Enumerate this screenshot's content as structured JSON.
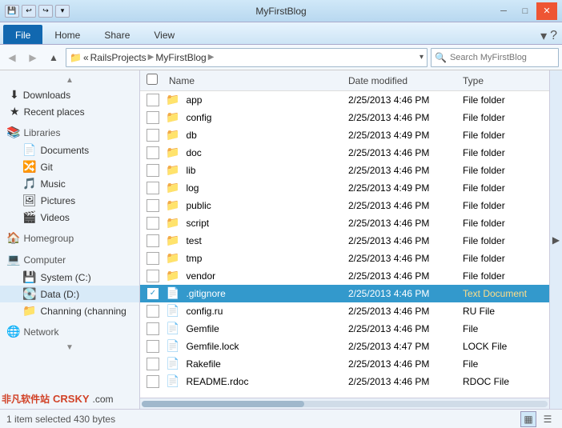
{
  "titleBar": {
    "title": "MyFirstBlog",
    "controls": {
      "minimize": "─",
      "maximize": "□",
      "close": "✕"
    }
  },
  "ribbonTabs": {
    "active": "File",
    "tabs": [
      "File",
      "Home",
      "Share",
      "View"
    ],
    "helpIcon": "?"
  },
  "addressBar": {
    "breadcrumb": [
      "RailsProjects",
      "MyFirstBlog"
    ],
    "searchPlaceholder": "Search MyFirstBlog"
  },
  "sidebar": {
    "items": [
      {
        "icon": "⬇",
        "label": "Downloads",
        "type": "item",
        "indent": 1
      },
      {
        "icon": "★",
        "label": "Recent places",
        "type": "item",
        "indent": 1
      },
      {
        "icon": "📚",
        "label": "Libraries",
        "type": "group"
      },
      {
        "icon": "📄",
        "label": "Documents",
        "type": "item",
        "indent": 1
      },
      {
        "icon": "🔀",
        "label": "Git",
        "type": "item",
        "indent": 1
      },
      {
        "icon": "🎵",
        "label": "Music",
        "type": "item",
        "indent": 1
      },
      {
        "icon": "🖼",
        "label": "Pictures",
        "type": "item",
        "indent": 1
      },
      {
        "icon": "🎬",
        "label": "Videos",
        "type": "item",
        "indent": 1
      },
      {
        "icon": "🏠",
        "label": "Homegroup",
        "type": "group"
      },
      {
        "icon": "💻",
        "label": "Computer",
        "type": "group"
      },
      {
        "icon": "💾",
        "label": "System (C:)",
        "type": "item",
        "indent": 1
      },
      {
        "icon": "💽",
        "label": "Data (D:)",
        "type": "item",
        "indent": 1
      },
      {
        "icon": "📁",
        "label": "Channing (channing",
        "type": "item",
        "indent": 1
      },
      {
        "icon": "🌐",
        "label": "Network",
        "type": "group"
      }
    ]
  },
  "filePane": {
    "columns": {
      "name": "Name",
      "dateModified": "Date modified",
      "type": "Type"
    },
    "files": [
      {
        "name": "app",
        "date": "2/25/2013 4:46 PM",
        "type": "File folder",
        "isFolder": true,
        "selected": false
      },
      {
        "name": "config",
        "date": "2/25/2013 4:46 PM",
        "type": "File folder",
        "isFolder": true,
        "selected": false
      },
      {
        "name": "db",
        "date": "2/25/2013 4:49 PM",
        "type": "File folder",
        "isFolder": true,
        "selected": false
      },
      {
        "name": "doc",
        "date": "2/25/2013 4:46 PM",
        "type": "File folder",
        "isFolder": true,
        "selected": false
      },
      {
        "name": "lib",
        "date": "2/25/2013 4:46 PM",
        "type": "File folder",
        "isFolder": true,
        "selected": false
      },
      {
        "name": "log",
        "date": "2/25/2013 4:49 PM",
        "type": "File folder",
        "isFolder": true,
        "selected": false
      },
      {
        "name": "public",
        "date": "2/25/2013 4:46 PM",
        "type": "File folder",
        "isFolder": true,
        "selected": false
      },
      {
        "name": "script",
        "date": "2/25/2013 4:46 PM",
        "type": "File folder",
        "isFolder": true,
        "selected": false
      },
      {
        "name": "test",
        "date": "2/25/2013 4:46 PM",
        "type": "File folder",
        "isFolder": true,
        "selected": false
      },
      {
        "name": "tmp",
        "date": "2/25/2013 4:46 PM",
        "type": "File folder",
        "isFolder": true,
        "selected": false
      },
      {
        "name": "vendor",
        "date": "2/25/2013 4:46 PM",
        "type": "File folder",
        "isFolder": true,
        "selected": false
      },
      {
        "name": ".gitignore",
        "date": "2/25/2013 4:46 PM",
        "type": "Text Document",
        "isFolder": false,
        "selected": true
      },
      {
        "name": "config.ru",
        "date": "2/25/2013 4:46 PM",
        "type": "RU File",
        "isFolder": false,
        "selected": false
      },
      {
        "name": "Gemfile",
        "date": "2/25/2013 4:46 PM",
        "type": "File",
        "isFolder": false,
        "selected": false
      },
      {
        "name": "Gemfile.lock",
        "date": "2/25/2013 4:47 PM",
        "type": "LOCK File",
        "isFolder": false,
        "selected": false
      },
      {
        "name": "Rakefile",
        "date": "2/25/2013 4:46 PM",
        "type": "File",
        "isFolder": false,
        "selected": false
      },
      {
        "name": "README.rdoc",
        "date": "2/25/2013 4:46 PM",
        "type": "RDOC File",
        "isFolder": false,
        "selected": false
      }
    ]
  },
  "statusBar": {
    "text": "1 item selected  430 bytes",
    "viewIcons": [
      "▦",
      "☰"
    ]
  }
}
